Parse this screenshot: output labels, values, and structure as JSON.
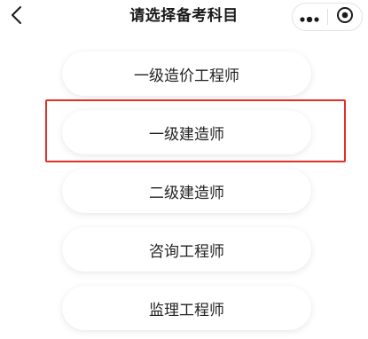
{
  "header": {
    "title": "请选择备考科目",
    "back_icon": "chevron-left-icon",
    "more_icon": "more-dots-icon",
    "close_icon": "target-close-icon"
  },
  "options": [
    {
      "label": "一级造价工程师"
    },
    {
      "label": "一级建造师",
      "highlighted": true
    },
    {
      "label": "二级建造师"
    },
    {
      "label": "咨询工程师"
    },
    {
      "label": "监理工程师"
    }
  ],
  "colors": {
    "highlight_border": "#e0302a",
    "text": "#222222"
  }
}
